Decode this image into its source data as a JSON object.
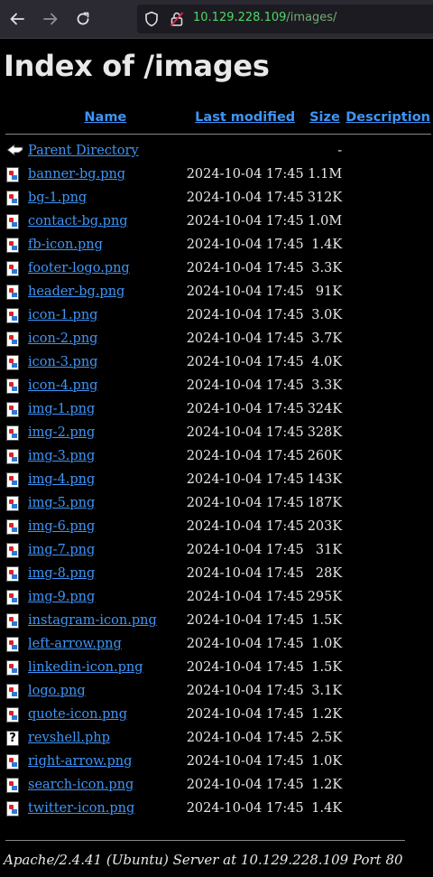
{
  "browser": {
    "url_host": "10.129.228.109",
    "url_path": "/images/"
  },
  "page": {
    "title": "Index of /images"
  },
  "columns": {
    "name": "Name",
    "last_modified": "Last modified",
    "size": "Size",
    "description": "Description"
  },
  "parent": {
    "label": "Parent Directory",
    "size": "-"
  },
  "files": [
    {
      "name": "banner-bg.png",
      "modified": "2024-10-04 17:45",
      "size": "1.1M",
      "icon": "image-icon"
    },
    {
      "name": "bg-1.png",
      "modified": "2024-10-04 17:45",
      "size": "312K",
      "icon": "image-icon"
    },
    {
      "name": "contact-bg.png",
      "modified": "2024-10-04 17:45",
      "size": "1.0M",
      "icon": "image-icon"
    },
    {
      "name": "fb-icon.png",
      "modified": "2024-10-04 17:45",
      "size": "1.4K",
      "icon": "image-icon"
    },
    {
      "name": "footer-logo.png",
      "modified": "2024-10-04 17:45",
      "size": "3.3K",
      "icon": "image-icon"
    },
    {
      "name": "header-bg.png",
      "modified": "2024-10-04 17:45",
      "size": "91K",
      "icon": "image-icon"
    },
    {
      "name": "icon-1.png",
      "modified": "2024-10-04 17:45",
      "size": "3.0K",
      "icon": "image-icon"
    },
    {
      "name": "icon-2.png",
      "modified": "2024-10-04 17:45",
      "size": "3.7K",
      "icon": "image-icon"
    },
    {
      "name": "icon-3.png",
      "modified": "2024-10-04 17:45",
      "size": "4.0K",
      "icon": "image-icon"
    },
    {
      "name": "icon-4.png",
      "modified": "2024-10-04 17:45",
      "size": "3.3K",
      "icon": "image-icon"
    },
    {
      "name": "img-1.png",
      "modified": "2024-10-04 17:45",
      "size": "324K",
      "icon": "image-icon"
    },
    {
      "name": "img-2.png",
      "modified": "2024-10-04 17:45",
      "size": "328K",
      "icon": "image-icon"
    },
    {
      "name": "img-3.png",
      "modified": "2024-10-04 17:45",
      "size": "260K",
      "icon": "image-icon"
    },
    {
      "name": "img-4.png",
      "modified": "2024-10-04 17:45",
      "size": "143K",
      "icon": "image-icon"
    },
    {
      "name": "img-5.png",
      "modified": "2024-10-04 17:45",
      "size": "187K",
      "icon": "image-icon"
    },
    {
      "name": "img-6.png",
      "modified": "2024-10-04 17:45",
      "size": "203K",
      "icon": "image-icon"
    },
    {
      "name": "img-7.png",
      "modified": "2024-10-04 17:45",
      "size": "31K",
      "icon": "image-icon"
    },
    {
      "name": "img-8.png",
      "modified": "2024-10-04 17:45",
      "size": "28K",
      "icon": "image-icon"
    },
    {
      "name": "img-9.png",
      "modified": "2024-10-04 17:45",
      "size": "295K",
      "icon": "image-icon"
    },
    {
      "name": "instagram-icon.png",
      "modified": "2024-10-04 17:45",
      "size": "1.5K",
      "icon": "image-icon"
    },
    {
      "name": "left-arrow.png",
      "modified": "2024-10-04 17:45",
      "size": "1.0K",
      "icon": "image-icon"
    },
    {
      "name": "linkedin-icon.png",
      "modified": "2024-10-04 17:45",
      "size": "1.5K",
      "icon": "image-icon"
    },
    {
      "name": "logo.png",
      "modified": "2024-10-04 17:45",
      "size": "3.1K",
      "icon": "image-icon"
    },
    {
      "name": "quote-icon.png",
      "modified": "2024-10-04 17:45",
      "size": "1.2K",
      "icon": "image-icon"
    },
    {
      "name": "revshell.php",
      "modified": "2024-10-04 17:45",
      "size": "2.5K",
      "icon": "unknown-file-icon"
    },
    {
      "name": "right-arrow.png",
      "modified": "2024-10-04 17:45",
      "size": "1.0K",
      "icon": "image-icon"
    },
    {
      "name": "search-icon.png",
      "modified": "2024-10-04 17:45",
      "size": "1.2K",
      "icon": "image-icon"
    },
    {
      "name": "twitter-icon.png",
      "modified": "2024-10-04 17:45",
      "size": "1.4K",
      "icon": "image-icon"
    }
  ],
  "footer": {
    "address": "Apache/2.4.41 (Ubuntu) Server at 10.129.228.109 Port 80"
  },
  "colors": {
    "link": "#3f95f7",
    "background": "#000000",
    "text": "#e8e8e8",
    "url_host": "#4cd964"
  }
}
